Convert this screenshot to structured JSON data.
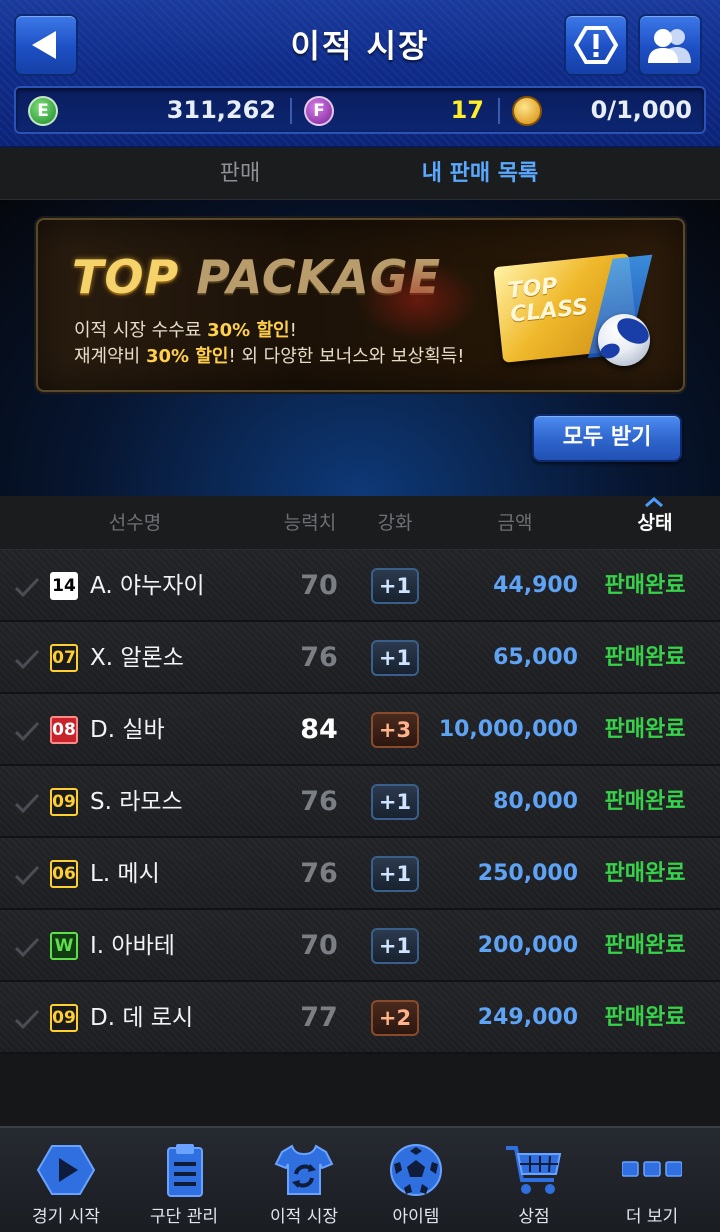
{
  "header": {
    "title": "이적 시장"
  },
  "currency": {
    "e_label": "E",
    "e_value": "311,262",
    "f_label": "F",
    "f_value": "17",
    "g_value": "0/1,000"
  },
  "tabs": {
    "sell": "판매",
    "my_list": "내 판매 목록"
  },
  "banner": {
    "title_top": "TOP",
    "title_package": "PACKAGE",
    "line1_pre": "이적 시장 수수료 ",
    "line1_hl": "30% 할인",
    "line1_post": "!",
    "line2_pre": "재계약비 ",
    "line2_hl": "30% 할인",
    "line2_post": "! 외 다양한 보너스와 보상획득!",
    "card_line1": "TOP",
    "card_line2": "CLASS"
  },
  "receive_all": "모두 받기",
  "columns": {
    "name": "선수명",
    "ovr": "능력치",
    "enhance": "강화",
    "price": "금액",
    "status": "상태"
  },
  "rows": [
    {
      "pos": "14",
      "name": "A. 야누자이",
      "ovr": "70",
      "enh": "+1",
      "price": "44,900",
      "status": "판매완료"
    },
    {
      "pos": "07",
      "name": "X. 알론소",
      "ovr": "76",
      "enh": "+1",
      "price": "65,000",
      "status": "판매완료"
    },
    {
      "pos": "08",
      "name": "D. 실바",
      "ovr": "84",
      "enh": "+3",
      "price": "10,000,000",
      "status": "판매완료"
    },
    {
      "pos": "09",
      "name": "S. 라모스",
      "ovr": "76",
      "enh": "+1",
      "price": "80,000",
      "status": "판매완료"
    },
    {
      "pos": "06",
      "name": "L. 메시",
      "ovr": "76",
      "enh": "+1",
      "price": "250,000",
      "status": "판매완료"
    },
    {
      "pos": "W",
      "name": "I. 아바테",
      "ovr": "70",
      "enh": "+1",
      "price": "200,000",
      "status": "판매완료"
    },
    {
      "pos": "09",
      "name": "D. 데 로시",
      "ovr": "77",
      "enh": "+2",
      "price": "249,000",
      "status": "판매완료"
    }
  ],
  "nav": [
    {
      "label": "경기 시작",
      "icon": "play-icon"
    },
    {
      "label": "구단 관리",
      "icon": "clipboard-icon"
    },
    {
      "label": "이적 시장",
      "icon": "jersey-transfer-icon"
    },
    {
      "label": "아이템",
      "icon": "soccer-ball-icon"
    },
    {
      "label": "상점",
      "icon": "cart-icon"
    },
    {
      "label": "더 보기",
      "icon": "more-dots-icon"
    }
  ],
  "colors": {
    "header_blue": "#0f2c8a",
    "price_blue": "#5fa3f5",
    "status_green": "#37d24a",
    "f_value_yellow": "#ffee2a",
    "active_tab": "#5aa9ff"
  }
}
